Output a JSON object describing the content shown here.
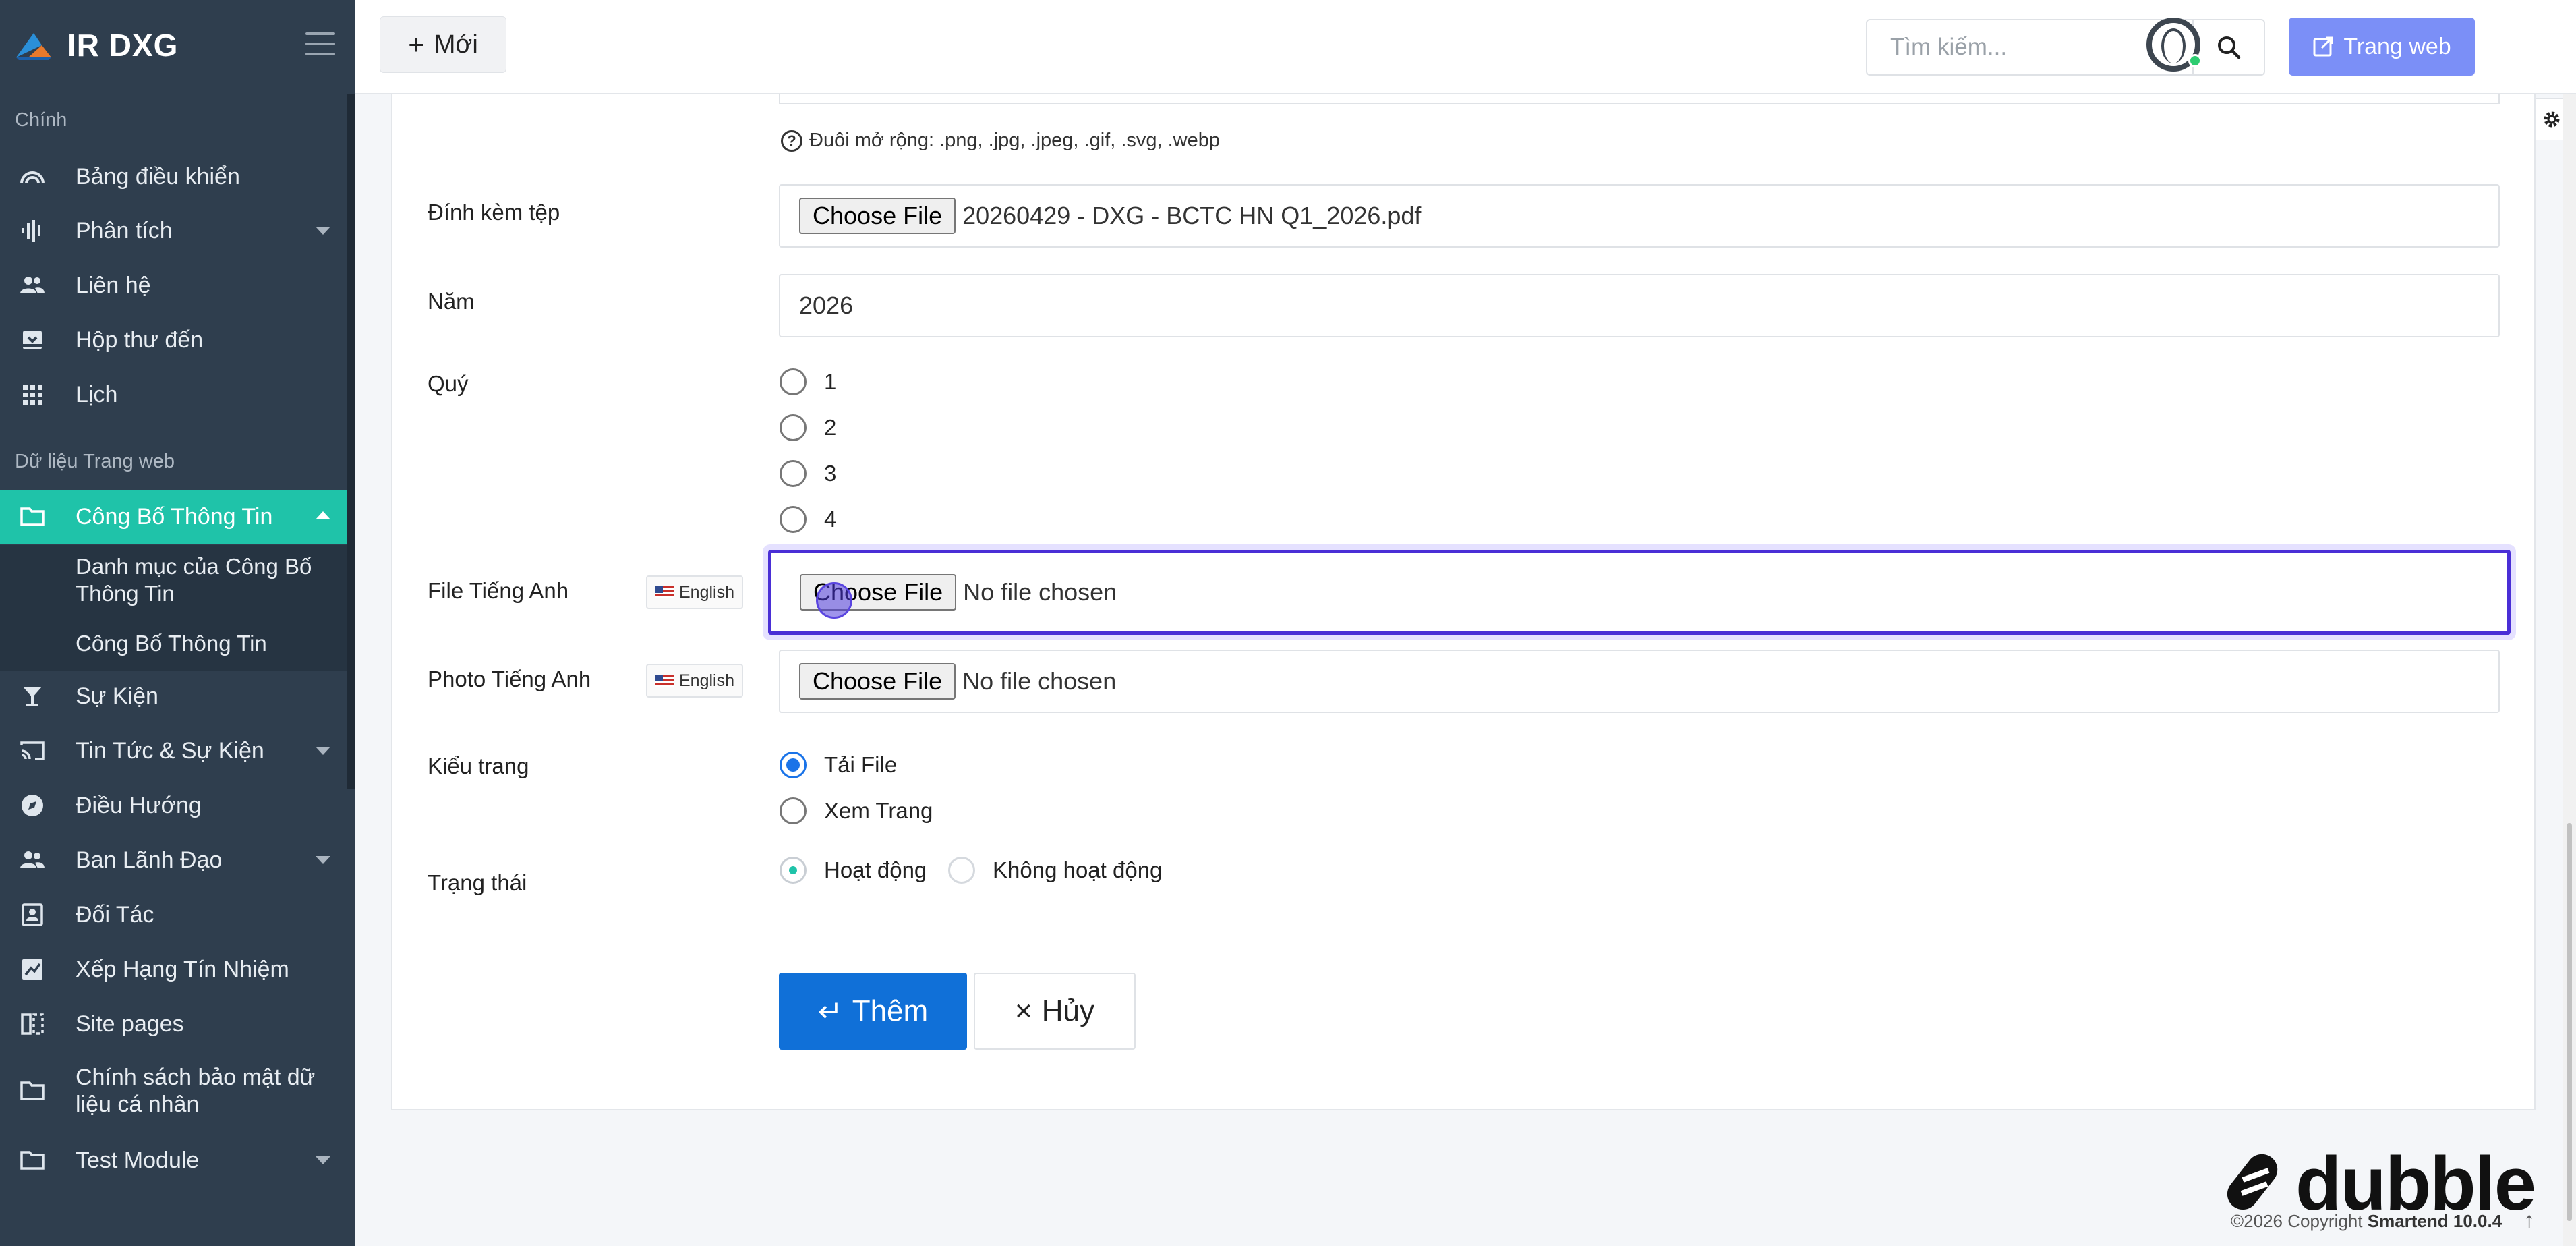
{
  "app": {
    "title": "IR DXG"
  },
  "sidebar": {
    "section_main": "Chính",
    "section_web": "Dữ liệu Trang web",
    "items": [
      {
        "label": "Bảng điều khiển",
        "icon": "dashboard-icon"
      },
      {
        "label": "Phân tích",
        "icon": "analytics-icon"
      },
      {
        "label": "Liên hệ",
        "icon": "contacts-icon"
      },
      {
        "label": "Hộp thư đến",
        "icon": "inbox-icon"
      },
      {
        "label": "Lịch",
        "icon": "calendar-grid-icon"
      },
      {
        "label": "Công Bố Thông Tin",
        "icon": "folder-icon"
      },
      {
        "label": "Sự Kiện",
        "icon": "cocktail-icon"
      },
      {
        "label": "Tin Tức & Sự Kiện",
        "icon": "cast-icon"
      },
      {
        "label": "Điều Hướng",
        "icon": "compass-icon"
      },
      {
        "label": "Ban Lãnh Đạo",
        "icon": "people-icon"
      },
      {
        "label": "Đối Tác",
        "icon": "contact-card-icon"
      },
      {
        "label": "Xếp Hạng Tín Nhiệm",
        "icon": "rating-icon"
      },
      {
        "label": "Site pages",
        "icon": "pages-icon"
      },
      {
        "label": "Chính sách bảo mật dữ liệu cá nhân",
        "icon": "folder-icon"
      },
      {
        "label": "Test Module",
        "icon": "folder-icon"
      }
    ],
    "subitems": [
      "Danh mục của Công Bố Thông Tin",
      "Công Bố Thông Tin"
    ]
  },
  "topbar": {
    "new_label": "Mới",
    "search_placeholder": "Tìm kiếm...",
    "web_label": "Trang web"
  },
  "form": {
    "hint": "Đuôi mở rộng: .png, .jpg, .jpeg, .gif, .svg, .webp",
    "attach_label": "Đính kèm tệp",
    "choose_file": "Choose File",
    "attach_file": "20260429 - DXG - BCTC HN Q1_2026.pdf",
    "year_label": "Năm",
    "year_value": "2026",
    "quarter_label": "Quý",
    "quarters": [
      "1",
      "2",
      "3",
      "4"
    ],
    "file_en_label": "File Tiếng Anh",
    "photo_en_label": "Photo Tiếng Anh",
    "lang_badge": "English",
    "no_file": "No file chosen",
    "page_type_label": "Kiểu trang",
    "page_types": [
      "Tải File",
      "Xem Trang"
    ],
    "status_label": "Trạng thái",
    "status_active": "Hoạt động",
    "status_inactive": "Không hoạt động",
    "submit": "Thêm",
    "cancel": "Hủy"
  },
  "footer": {
    "copyright_prefix": "©2026 Copyright",
    "copyright_brand": "Smartend 10.0.4",
    "watermark": "dubble"
  },
  "colors": {
    "sidebar": "#2f3e4e",
    "active": "#1fc3a9",
    "primary": "#1070d8",
    "web_button": "#7b8ff7",
    "focus": "#4a2fd6"
  }
}
